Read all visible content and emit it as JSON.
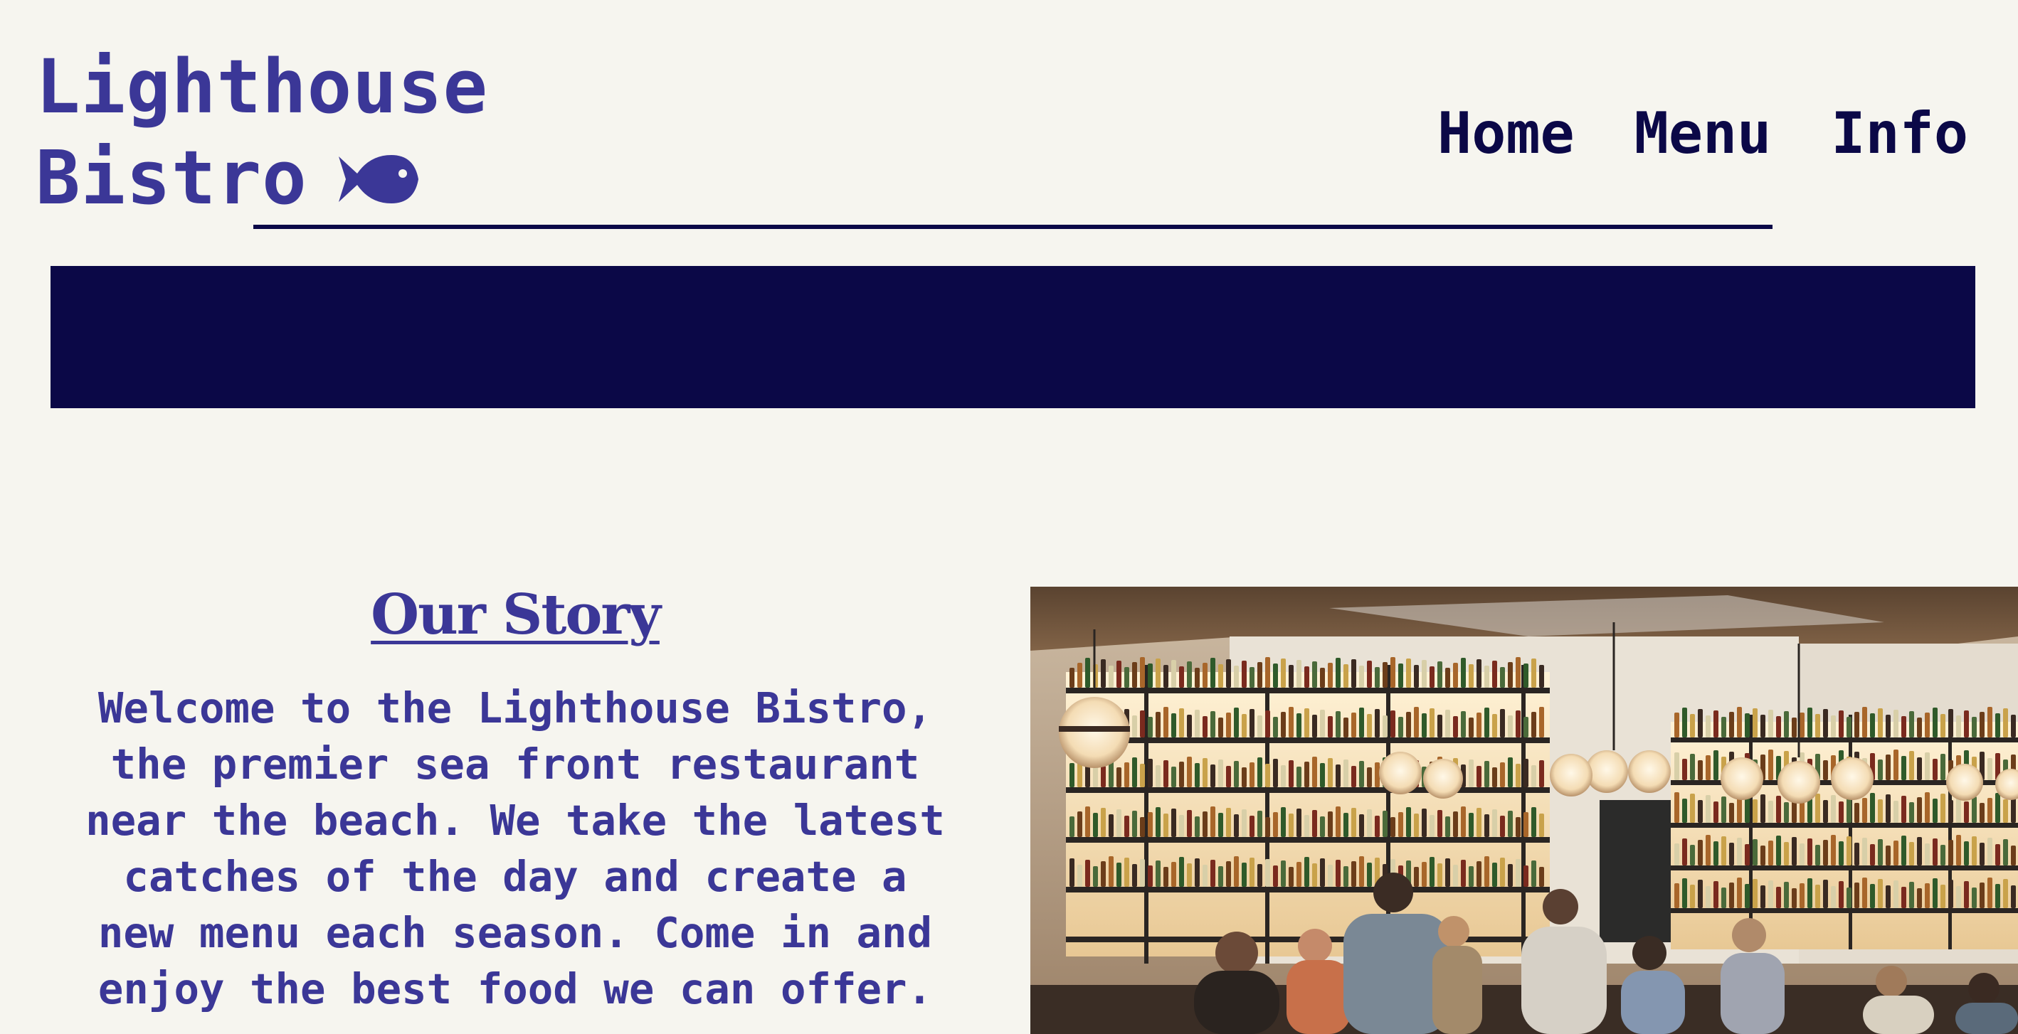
{
  "header": {
    "logo_line1": "Lighthouse",
    "logo_line2": "Bistro",
    "logo_icon": "fish-icon",
    "nav": [
      {
        "label": "Home"
      },
      {
        "label": "Menu"
      },
      {
        "label": "Info"
      }
    ]
  },
  "story": {
    "title": "Our Story",
    "body": "Welcome to the Lighthouse Bistro, the premier sea front restaurant near the beach. We take the latest catches of the day and create a new menu each season. Come in and enjoy the best food we can offer."
  },
  "photo": {
    "subject": "restaurant bar interior"
  },
  "colors": {
    "background": "#f6f5ef",
    "primary": "#3b3797",
    "dark": "#0b0847"
  }
}
